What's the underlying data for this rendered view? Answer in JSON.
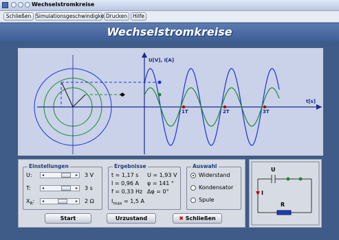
{
  "window": {
    "title": "Wechselstromkreise"
  },
  "menu": [
    "Schließen",
    "Simulationsgeschwindigkeit",
    "Drucken",
    "Hilfe"
  ],
  "app_title": "Wechselstromkreise",
  "plot": {
    "y_axis_label": "U[V], I[A]",
    "x_axis_label": "t[s]",
    "ticks": [
      "1T",
      "2T",
      "3T"
    ],
    "colors": {
      "voltage": "#1f2fe0",
      "current": "#1a8a2a",
      "axis": "#1a2a8a"
    }
  },
  "einstellungen": {
    "title": "Einstellungen",
    "rows": [
      {
        "label": "U:",
        "value": "3 V",
        "level": 0.55
      },
      {
        "label": "T:",
        "value": "3 s",
        "level": 0.55
      },
      {
        "label": "X",
        "sub": "R",
        "suffix": ":",
        "value": "2 Ω",
        "level": 0.45
      }
    ]
  },
  "ergebnisse": {
    "title": "Ergebnisse",
    "rows": [
      [
        "t = 1,17 s",
        "U = 1,93 V"
      ],
      [
        "I = 0,96 A",
        "φ = 141 °"
      ],
      [
        "f = 0,33 Hz",
        "Δφ = 0°"
      ]
    ],
    "imax_label": "I",
    "imax_sub": "max",
    "imax_value": " = 1,5 A"
  },
  "auswahl": {
    "title": "Auswahl",
    "options": [
      "Widerstand",
      "Kondensator",
      "Spule"
    ],
    "selected": 0
  },
  "buttons": {
    "start": "Start",
    "urzustand": "Urzustand",
    "schliessen": "Schließen"
  },
  "circuit": {
    "u_label": "U",
    "i_label": "I",
    "r_label": "R"
  }
}
